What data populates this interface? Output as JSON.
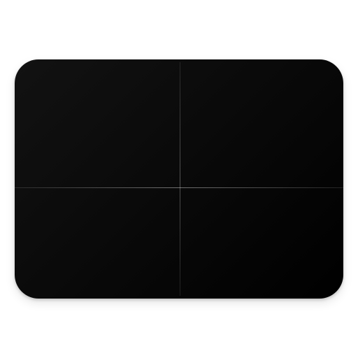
{
  "icon": {
    "name": "trackpad-icon",
    "colors": {
      "background": "#ffffff",
      "surface": "#0a0a0a",
      "divider": "#5a5a5a"
    }
  }
}
